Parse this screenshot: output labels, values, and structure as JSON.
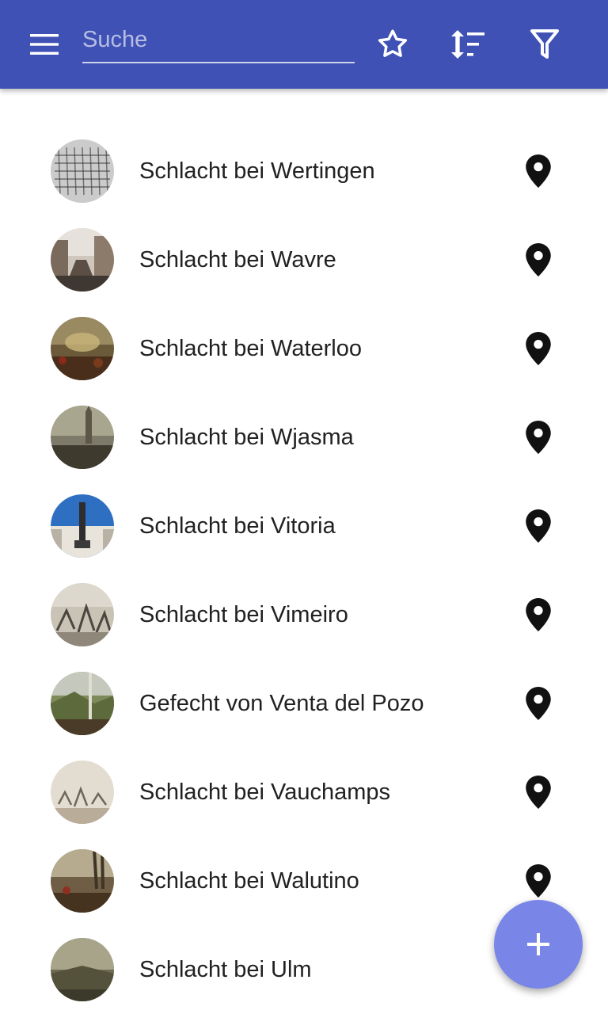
{
  "toolbar": {
    "search_placeholder": "Suche",
    "menu_icon": "menu-icon",
    "favorites_icon": "star-outline-icon",
    "sort_icon": "sort-icon",
    "filter_icon": "filter-icon",
    "color": "#3f51b5"
  },
  "items": [
    {
      "title": "Schlacht bei Wertingen",
      "thumb_icon": "engraving-image",
      "action_icon": "map-pin-icon"
    },
    {
      "title": "Schlacht bei Wavre",
      "thumb_icon": "street-photo-image",
      "action_icon": "map-pin-icon"
    },
    {
      "title": "Schlacht bei Waterloo",
      "thumb_icon": "battle-painting-image",
      "action_icon": "map-pin-icon"
    },
    {
      "title": "Schlacht bei Wjasma",
      "thumb_icon": "battle-painting-image",
      "action_icon": "map-pin-icon"
    },
    {
      "title": "Schlacht bei Vitoria",
      "thumb_icon": "monument-photo-image",
      "action_icon": "map-pin-icon"
    },
    {
      "title": "Schlacht bei Vimeiro",
      "thumb_icon": "engraving-image",
      "action_icon": "map-pin-icon"
    },
    {
      "title": "Gefecht von Venta del Pozo",
      "thumb_icon": "landscape-photo-image",
      "action_icon": "map-pin-icon"
    },
    {
      "title": "Schlacht bei Vauchamps",
      "thumb_icon": "battle-sketch-image",
      "action_icon": "map-pin-icon"
    },
    {
      "title": "Schlacht bei Walutino",
      "thumb_icon": "battle-painting-image",
      "action_icon": "map-pin-icon"
    },
    {
      "title": "Schlacht bei Ulm",
      "thumb_icon": "landscape-painting-image",
      "action_icon": "map-pin-icon"
    }
  ],
  "fab": {
    "icon": "plus-icon",
    "color": "#7986e8"
  }
}
